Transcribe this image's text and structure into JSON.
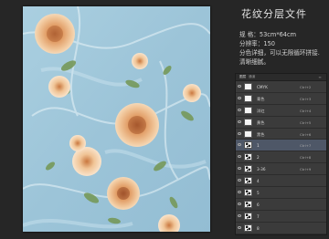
{
  "header": {
    "title": "花纹分层文件"
  },
  "info": {
    "size": "规 格：53cm*64cm",
    "resolution": "分辨率：150",
    "note_1": "分色详细，可以无限循环拼接.",
    "note_2": "清晰细腻。"
  },
  "layers_panel": {
    "tabs": [
      "图层",
      "通道"
    ],
    "menu_icon": "panel-menu-icon",
    "layers": [
      {
        "name": "CMYK",
        "shortcut": "Ctrl+2",
        "thumb": "blank",
        "selected": false
      },
      {
        "name": "青色",
        "shortcut": "Ctrl+3",
        "thumb": "blank",
        "selected": false
      },
      {
        "name": "洋红",
        "shortcut": "Ctrl+4",
        "thumb": "blank",
        "selected": false
      },
      {
        "name": "黄色",
        "shortcut": "Ctrl+5",
        "thumb": "blank",
        "selected": false
      },
      {
        "name": "黑色",
        "shortcut": "Ctrl+6",
        "thumb": "blank",
        "selected": false
      },
      {
        "name": "1",
        "shortcut": "Ctrl+7",
        "thumb": "pattern",
        "selected": true
      },
      {
        "name": "2",
        "shortcut": "Ctrl+8",
        "thumb": "pattern",
        "selected": false
      },
      {
        "name": "3-36",
        "shortcut": "Ctrl+9",
        "thumb": "pattern",
        "selected": false
      },
      {
        "name": "4",
        "shortcut": "",
        "thumb": "pattern",
        "selected": false
      },
      {
        "name": "5",
        "shortcut": "",
        "thumb": "pattern",
        "selected": false
      },
      {
        "name": "6",
        "shortcut": "",
        "thumb": "pattern",
        "selected": false
      },
      {
        "name": "7",
        "shortcut": "",
        "thumb": "pattern",
        "selected": false
      },
      {
        "name": "8",
        "shortcut": "",
        "thumb": "pattern",
        "selected": false
      }
    ]
  },
  "colors": {
    "background": "#262626",
    "preview_base": "#9fc6d9",
    "flower_orange": "#e2a06a",
    "flower_peach": "#f1d6bd",
    "leaf_green": "#76995a",
    "selected_layer": "#4e5767"
  }
}
